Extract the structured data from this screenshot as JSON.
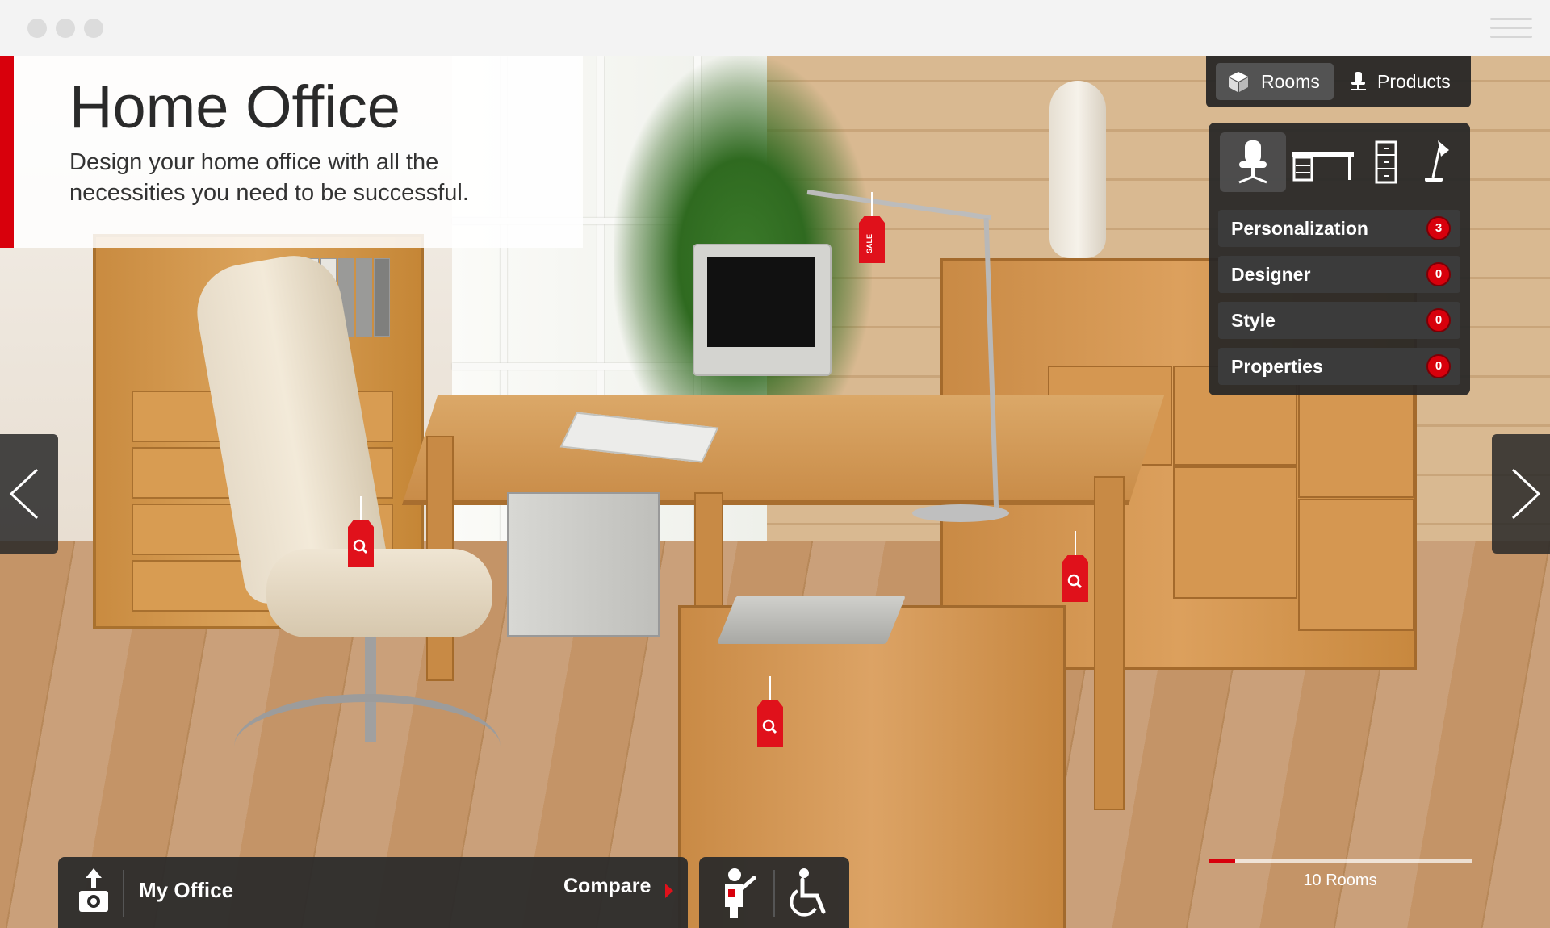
{
  "page": {
    "title": "Home Office",
    "subtitle": "Design your home office with all the necessities you need to be successful."
  },
  "tabs": {
    "rooms": "Rooms",
    "products": "Products",
    "active": "Rooms"
  },
  "categories": [
    {
      "icon": "office-chair-icon",
      "active": true
    },
    {
      "icon": "desk-icon",
      "active": false
    },
    {
      "icon": "file-cabinet-icon",
      "active": false
    },
    {
      "icon": "desk-lamp-icon",
      "active": false
    }
  ],
  "filters": [
    {
      "label": "Personalization",
      "count": "3"
    },
    {
      "label": "Designer",
      "count": "0"
    },
    {
      "label": "Style",
      "count": "0"
    },
    {
      "label": "Properties",
      "count": "0"
    }
  ],
  "tags": [
    {
      "type": "sale",
      "label": "SALE"
    },
    {
      "type": "search",
      "icon": "magnifier-icon"
    },
    {
      "type": "search",
      "icon": "magnifier-icon"
    },
    {
      "type": "search",
      "icon": "magnifier-icon"
    }
  ],
  "bottom": {
    "my_office": "My Office",
    "compare": "Compare"
  },
  "rooms": {
    "count_label": "10 Rooms",
    "current": 1,
    "total": 10
  },
  "colors": {
    "accent": "#d8000c",
    "panel": "#262626"
  }
}
